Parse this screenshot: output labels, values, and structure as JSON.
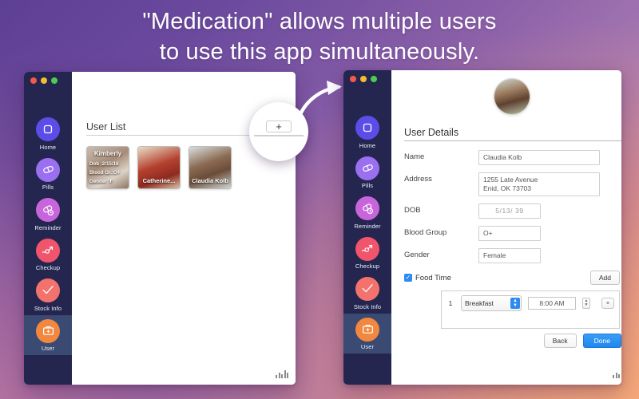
{
  "headline": {
    "line1": "\"Medication\" allows multiple users",
    "line2": "to use this app simultaneously."
  },
  "colors": {
    "sidebar_bg": "#24264f",
    "sidebar_active_bg": "#3a4a72",
    "accent_blue": "#2b8bf0",
    "home_icon": "#5b4ee8",
    "pills_icon": "#9a6ff0",
    "reminder_icon": "#c864dc",
    "checkup_icon": "#f0556b",
    "stock_icon": "#f4726e",
    "user_icon": "#f2883f"
  },
  "sidebar": {
    "items": [
      {
        "label": "Home",
        "icon": "home-square-icon",
        "color": "#5b4ee8",
        "active": false
      },
      {
        "label": "Pills",
        "icon": "capsule-icon",
        "color": "#9a6ff0",
        "active": false
      },
      {
        "label": "Reminder",
        "icon": "capsule-clock-icon",
        "color": "#c864dc",
        "active": false
      },
      {
        "label": "Checkup",
        "icon": "trend-arrow-icon",
        "color": "#f0556b",
        "active": false
      },
      {
        "label": "Stock Info",
        "icon": "checkmark-icon",
        "color": "#f4726e",
        "active": false
      },
      {
        "label": "User",
        "icon": "medical-kit-icon",
        "color": "#f2883f",
        "active": true
      }
    ]
  },
  "left_window": {
    "traffic_lights": [
      "close",
      "minimize",
      "zoom"
    ],
    "section_title": "User List",
    "users": [
      {
        "name": "Kimberly",
        "show_details": true,
        "dob": "Dob :2/15/16",
        "blood_group": "Blood Gr.:O+",
        "gender": "Gender :F"
      },
      {
        "name": "Catherine...",
        "show_details": false
      },
      {
        "name": "Claudia Kolb",
        "show_details": false
      }
    ],
    "callout": {
      "add_button_label": "+"
    }
  },
  "right_window": {
    "traffic_lights": [
      "close",
      "minimize",
      "zoom"
    ],
    "avatar_name": "Claudia Kolb",
    "details_title": "User Details",
    "fields": [
      {
        "label": "Name",
        "value": "Claudia Kolb"
      },
      {
        "label": "Address",
        "value": "1255 Late Avenue\nEnid, OK 73703"
      },
      {
        "label": "DOB",
        "value": "5/13/  39"
      },
      {
        "label": "Blood Group",
        "value": "O+"
      },
      {
        "label": "Gender",
        "value": "Female"
      }
    ],
    "food_time": {
      "label": "Food Time",
      "checked": true,
      "add_label": "Add",
      "rows": [
        {
          "index": "1",
          "meal": "Breakfast",
          "time": "8:00 AM",
          "remove_label": "×"
        }
      ]
    },
    "footer": {
      "back_label": "Back",
      "done_label": "Done"
    }
  }
}
